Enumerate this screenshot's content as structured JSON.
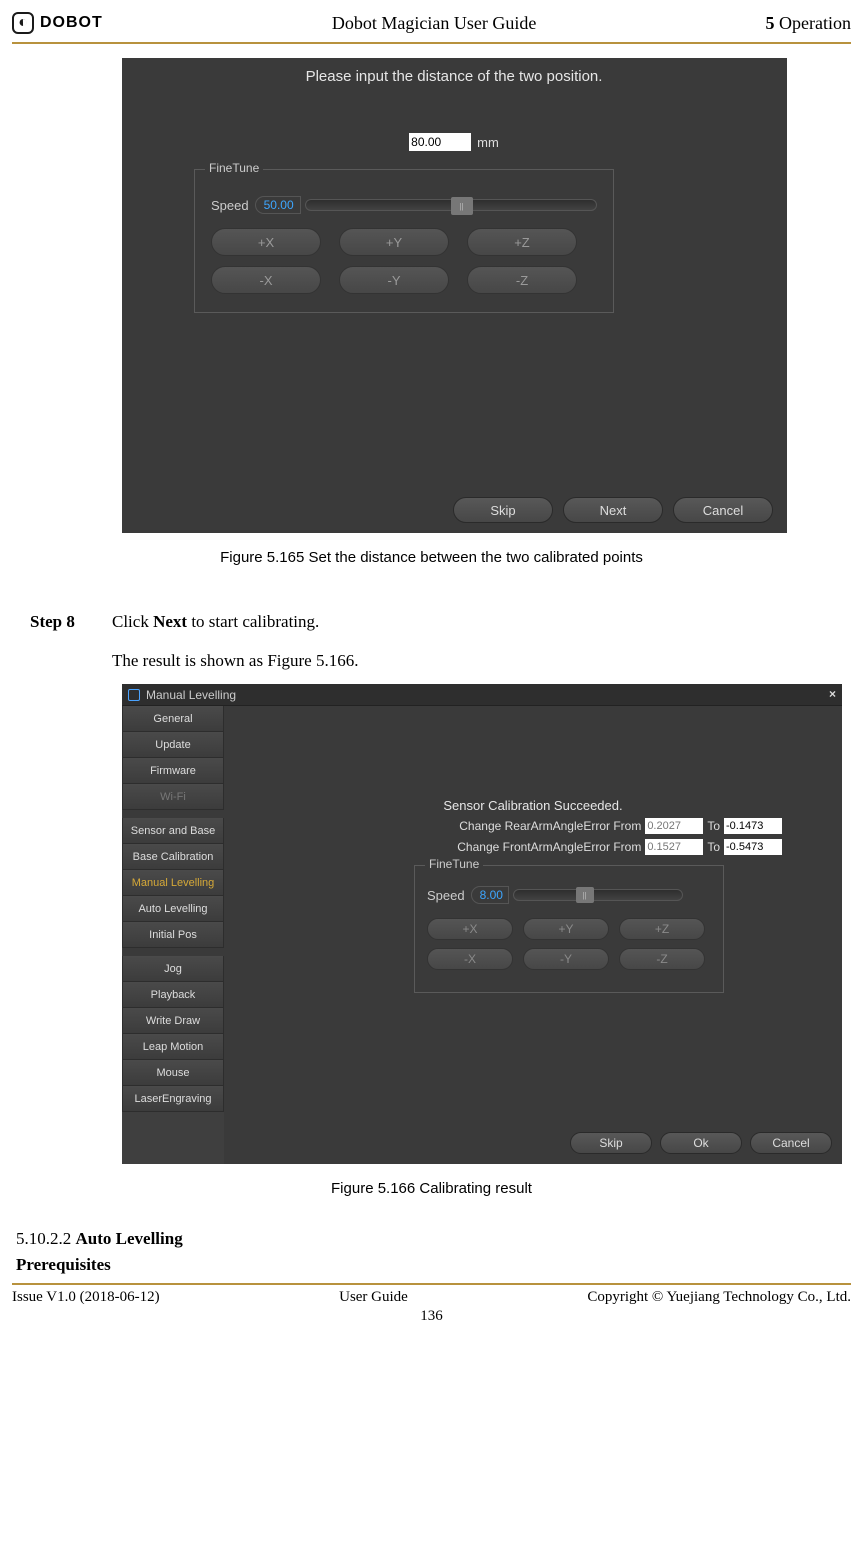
{
  "header": {
    "logo_brand": "DOBOT",
    "center": "Dobot Magician User Guide",
    "right_bold": "5",
    "right_text": " Operation"
  },
  "fig1": {
    "prompt": "Please input the distance of the two position.",
    "distance_value": "80.00",
    "distance_unit": "mm",
    "finetune_legend": "FineTune",
    "speed_label": "Speed",
    "speed_value": "50.00",
    "btn_px": "+X",
    "btn_py": "+Y",
    "btn_pz": "+Z",
    "btn_mx": "-X",
    "btn_my": "-Y",
    "btn_mz": "-Z",
    "skip": "Skip",
    "next": "Next",
    "cancel": "Cancel",
    "caption": "Figure 5.165    Set the distance between the two calibrated points"
  },
  "step8": {
    "label": "Step 8",
    "line1a": "Click ",
    "line1b": "Next",
    "line1c": " to start calibrating.",
    "line2": "The result is shown as Figure 5.166."
  },
  "fig2": {
    "title": "Manual Levelling",
    "sidebar": {
      "general": "General",
      "update": "Update",
      "firmware": "Firmware",
      "wifi": "Wi-Fi",
      "sensor_base": "Sensor and Base",
      "base_calib": "Base Calibration",
      "manual_level": "Manual Levelling",
      "auto_level": "Auto Levelling",
      "initial_pos": "Initial Pos",
      "jog": "Jog",
      "playback": "Playback",
      "write_draw": "Write  Draw",
      "leap_motion": "Leap Motion",
      "mouse": "Mouse",
      "laser": "LaserEngraving"
    },
    "success": "Sensor Calibration Succeeded.",
    "rear_label": "Change RearArmAngleError From",
    "rear_from": "0.2027",
    "to_text": "To",
    "rear_to": "-0.1473",
    "front_label": "Change FrontArmAngleError From",
    "front_from": "0.1527",
    "front_to": "-0.5473",
    "finetune_legend": "FineTune",
    "speed_label": "Speed",
    "speed_value": "8.00",
    "btn_px": "+X",
    "btn_py": "+Y",
    "btn_pz": "+Z",
    "btn_mx": "-X",
    "btn_my": "-Y",
    "btn_mz": "-Z",
    "skip": "Skip",
    "ok": "Ok",
    "cancel": "Cancel",
    "caption": "Figure 5.166    Calibrating result"
  },
  "section": {
    "num": "5.10.2.2 ",
    "title": "Auto Levelling",
    "prereq": "Prerequisites"
  },
  "footer": {
    "left": "Issue V1.0 (2018-06-12)",
    "center": "User Guide",
    "right": "Copyright © Yuejiang Technology Co., Ltd.",
    "page": "136"
  }
}
